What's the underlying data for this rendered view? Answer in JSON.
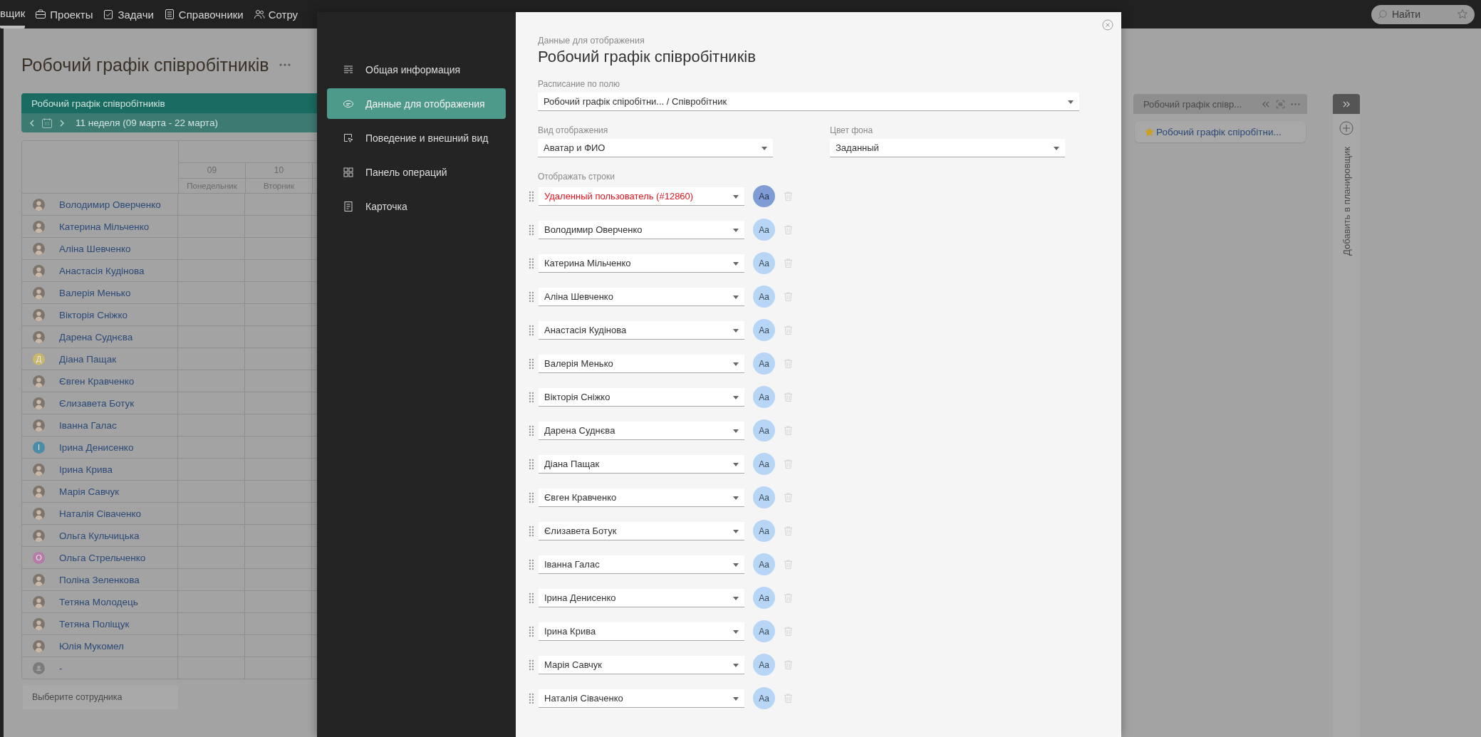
{
  "top_nav": {
    "items": [
      {
        "label": "вщик",
        "selected": true
      },
      {
        "label": "Проекты",
        "selected": false
      },
      {
        "label": "Задачи",
        "selected": false
      },
      {
        "label": "Справочники",
        "selected": false
      },
      {
        "label": "Сотру",
        "selected": false
      }
    ],
    "search": {
      "placeholder": "Найти"
    }
  },
  "page": {
    "title": "Робочий графік співробітників"
  },
  "schedule": {
    "header": "Робочий графік співробітників",
    "period": "11 неделя (09 марта - 22 марта)",
    "days": [
      {
        "date": "09",
        "weekday": "Понедельник"
      },
      {
        "date": "10",
        "weekday": "Вторник"
      }
    ],
    "employees": [
      {
        "name": "Володимир Оверченко",
        "kind": "photo"
      },
      {
        "name": "Катерина Мільченко",
        "kind": "photo"
      },
      {
        "name": "Аліна Шевченко",
        "kind": "photo"
      },
      {
        "name": "Анастасія Кудінова",
        "kind": "photo"
      },
      {
        "name": "Валерія Менько",
        "kind": "photo"
      },
      {
        "name": "Вікторія Сніжко",
        "kind": "photo"
      },
      {
        "name": "Дарена Суднєва",
        "kind": "photo"
      },
      {
        "name": "Діана Пащак",
        "kind": "initial",
        "initial": "Д",
        "color": "#c8b86c"
      },
      {
        "name": "Євген Кравченко",
        "kind": "photo"
      },
      {
        "name": "Єлизавета Ботук",
        "kind": "photo"
      },
      {
        "name": "Іванна Галас",
        "kind": "photo"
      },
      {
        "name": "Ірина Денисенко",
        "kind": "initial",
        "initial": "І",
        "color": "#4c8ca6"
      },
      {
        "name": "Ірина Крива",
        "kind": "photo"
      },
      {
        "name": "Марія Савчук",
        "kind": "photo"
      },
      {
        "name": "Наталія Сіваченко",
        "kind": "photo"
      },
      {
        "name": "Ольга Кульчицька",
        "kind": "photo"
      },
      {
        "name": "Ольга Стрельченко",
        "kind": "initial",
        "initial": "О",
        "color": "#b47ca6"
      },
      {
        "name": "Поліна Зеленкова",
        "kind": "photo"
      },
      {
        "name": "Тетяна Молодець",
        "kind": "photo"
      },
      {
        "name": "Тетяна Поліщук",
        "kind": "photo"
      },
      {
        "name": "Юлія Мукомел",
        "kind": "photo"
      },
      {
        "name": "-",
        "kind": "placeholder"
      }
    ],
    "add_button": "Выберите сотрудника"
  },
  "side_panel": {
    "title": "Робочий графік співр...",
    "card": "Робочий графік спіробітни...",
    "add_label": "Добавить в планировщик"
  },
  "modal": {
    "nav": [
      {
        "label": "Общая информация",
        "selected": false
      },
      {
        "label": "Данные для отображения",
        "selected": true
      },
      {
        "label": "Поведение и внешний вид",
        "selected": false
      },
      {
        "label": "Панель операций",
        "selected": false
      },
      {
        "label": "Карточка",
        "selected": false
      }
    ],
    "subtitle": "Данные для отображения",
    "title": "Робочий графік співробітників",
    "schedule_field": {
      "label": "Расписание по полю",
      "value": "Робочий графік спіробітни... / Співробітник"
    },
    "view_field": {
      "label": "Вид отображения",
      "value": "Аватар и ФИО"
    },
    "bg_field": {
      "label": "Цвет фона",
      "value": "Заданный"
    },
    "rows_label": "Отображать строки",
    "rows": [
      {
        "name": "Удаленный пользователь (#12860)",
        "deleted": true,
        "avatar_text": "Aa"
      },
      {
        "name": "Володимир Оверченко",
        "deleted": false,
        "avatar_text": "Aa"
      },
      {
        "name": "Катерина Мільченко",
        "deleted": false,
        "avatar_text": "Aa"
      },
      {
        "name": "Аліна Шевченко",
        "deleted": false,
        "avatar_text": "Aa"
      },
      {
        "name": "Анастасія Кудінова",
        "deleted": false,
        "avatar_text": "Aa"
      },
      {
        "name": "Валерія Менько",
        "deleted": false,
        "avatar_text": "Aa"
      },
      {
        "name": "Вікторія Сніжко",
        "deleted": false,
        "avatar_text": "Aa"
      },
      {
        "name": "Дарена Суднєва",
        "deleted": false,
        "avatar_text": "Aa"
      },
      {
        "name": "Діана Пащак",
        "deleted": false,
        "avatar_text": "Aa"
      },
      {
        "name": "Євген Кравченко",
        "deleted": false,
        "avatar_text": "Aa"
      },
      {
        "name": "Єлизавета Ботук",
        "deleted": false,
        "avatar_text": "Aa"
      },
      {
        "name": "Іванна Галас",
        "deleted": false,
        "avatar_text": "Aa"
      },
      {
        "name": "Ірина Денисенко",
        "deleted": false,
        "avatar_text": "Aa"
      },
      {
        "name": "Ірина Крива",
        "deleted": false,
        "avatar_text": "Aa"
      },
      {
        "name": "Марія Савчук",
        "deleted": false,
        "avatar_text": "Aa"
      },
      {
        "name": "Наталія Сіваченко",
        "deleted": false,
        "avatar_text": "Aa"
      }
    ]
  }
}
